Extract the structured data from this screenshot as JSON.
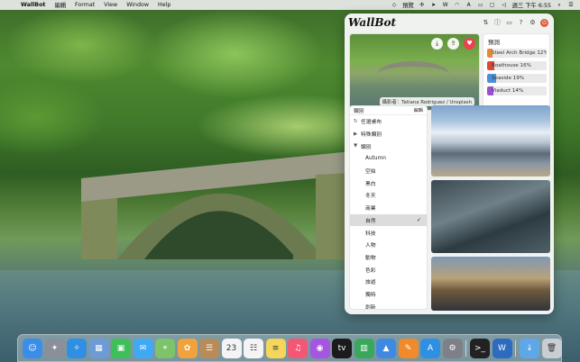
{
  "menubar": {
    "apple_glyph": "",
    "items": [
      "WallBot",
      "編輯",
      "Format",
      "View",
      "Window",
      "Help"
    ],
    "input_label": "預覽",
    "status_icons": [
      "dropbox-icon",
      "pinwheel-icon",
      "location-icon",
      "wallbot-icon",
      "wifi-icon",
      "accessibility-icon",
      "battery-icon",
      "airplay-icon",
      "volume-icon"
    ],
    "clock": "週三 下午 6:55"
  },
  "app": {
    "title": "WallBot",
    "toolbar_icons": [
      "pin-icon",
      "info-icon",
      "feedback-icon",
      "help-icon",
      "settings-icon",
      "power-icon"
    ],
    "preview": {
      "credit": "攝影者：Tatiana Rodriguez / Unsplash",
      "buttons": [
        "download-icon",
        "share-icon",
        "heart-icon"
      ]
    },
    "predictions": {
      "title": "預測",
      "items": [
        {
          "label": "Steel Arch Bridge 12%",
          "color": "#e8863a",
          "percent": 12
        },
        {
          "label": "Boathouse 16%",
          "color": "#d9493a",
          "percent": 16
        },
        {
          "label": "Seaside 19%",
          "color": "#4a8fd9",
          "percent": 19
        },
        {
          "label": "Viaduct 14%",
          "color": "#9a4fd0",
          "percent": 14
        }
      ]
    },
    "categories": {
      "header": "類別",
      "edit_label": "編輯",
      "items": [
        {
          "label": "任選桌布",
          "symbol": "↻",
          "sub": false
        },
        {
          "label": "特殊類別",
          "symbol": "▶",
          "sub": false
        },
        {
          "label": "類別",
          "symbol": "▼",
          "sub": false
        },
        {
          "label": "Autumn",
          "sub": true
        },
        {
          "label": "空拍",
          "sub": true
        },
        {
          "label": "黑白",
          "sub": true
        },
        {
          "label": "冬天",
          "sub": true
        },
        {
          "label": "商業",
          "sub": true
        },
        {
          "label": "自然",
          "sub": true,
          "selected": true
        },
        {
          "label": "科技",
          "sub": true
        },
        {
          "label": "人物",
          "sub": true
        },
        {
          "label": "動物",
          "sub": true
        },
        {
          "label": "色彩",
          "sub": true
        },
        {
          "label": "旅遊",
          "sub": true
        },
        {
          "label": "獨特",
          "sub": true
        },
        {
          "label": "創新",
          "sub": true
        }
      ]
    },
    "thumbnails": [
      "snowy-mountains",
      "coastal-road",
      "mountain-lake"
    ]
  },
  "dock": {
    "apps": [
      {
        "name": "finder",
        "color": "#3b8ee8",
        "glyph": "☺"
      },
      {
        "name": "launchpad",
        "color": "#8a8f99",
        "glyph": "✦"
      },
      {
        "name": "safari",
        "color": "#2f8fe3",
        "glyph": "✧"
      },
      {
        "name": "preview",
        "color": "#6c9bd6",
        "glyph": "▦"
      },
      {
        "name": "facetime",
        "color": "#3fbf5a",
        "glyph": "▣"
      },
      {
        "name": "messages",
        "color": "#3fa9f5",
        "glyph": "✉"
      },
      {
        "name": "maps",
        "color": "#7cc36a",
        "glyph": "⌖"
      },
      {
        "name": "photos",
        "color": "#f0a23c",
        "glyph": "✿"
      },
      {
        "name": "contacts",
        "color": "#b88c5a",
        "glyph": "☰"
      },
      {
        "name": "calendar",
        "color": "#f4f4f4",
        "glyph": "23"
      },
      {
        "name": "reminders",
        "color": "#f4f4f4",
        "glyph": "☷"
      },
      {
        "name": "notes",
        "color": "#f5d55a",
        "glyph": "≡"
      },
      {
        "name": "music",
        "color": "#f25775",
        "glyph": "♫"
      },
      {
        "name": "podcasts",
        "color": "#a655e0",
        "glyph": "◉"
      },
      {
        "name": "tv",
        "color": "#1b1b1b",
        "glyph": "tv"
      },
      {
        "name": "numbers",
        "color": "#3aa85a",
        "glyph": "▥"
      },
      {
        "name": "keynote",
        "color": "#3f8ae0",
        "glyph": "▲"
      },
      {
        "name": "pages",
        "color": "#f08a2c",
        "glyph": "✎"
      },
      {
        "name": "app-store",
        "color": "#2f8fe3",
        "glyph": "A"
      },
      {
        "name": "system-preferences",
        "color": "#7d8087",
        "glyph": "⚙"
      },
      {
        "name": "terminal",
        "color": "#222",
        "glyph": ">_"
      },
      {
        "name": "wallbot",
        "color": "#2d6bbf",
        "glyph": "W"
      },
      {
        "name": "downloads-folder",
        "color": "#5fa8e8",
        "glyph": "↓"
      },
      {
        "name": "trash",
        "color": "#c9ced4",
        "glyph": "🗑"
      }
    ]
  }
}
